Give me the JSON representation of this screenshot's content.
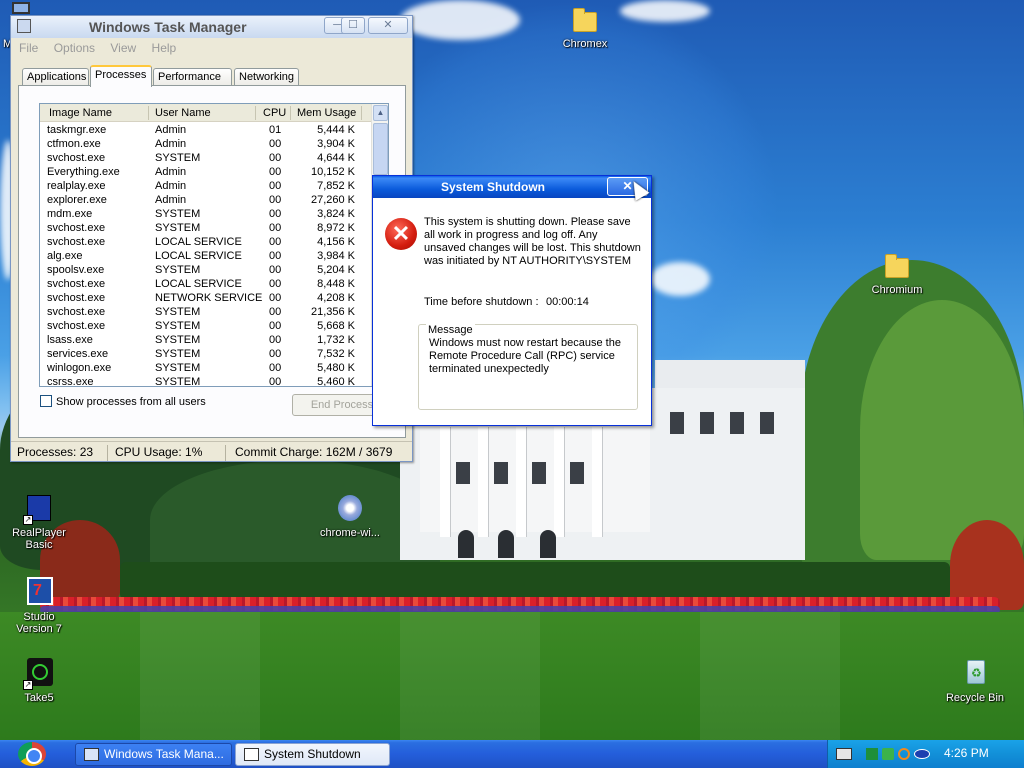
{
  "desktop": {
    "icons": [
      {
        "id": "chromex",
        "label": "Chromex"
      },
      {
        "id": "chromium",
        "label": "Chromium"
      },
      {
        "id": "realplayer",
        "label": "RealPlayer Basic"
      },
      {
        "id": "chrome-wi",
        "label": "chrome-wi..."
      },
      {
        "id": "studio",
        "label": "Studio Version 7"
      },
      {
        "id": "take5",
        "label": "Take5"
      },
      {
        "id": "recycle",
        "label": "Recycle Bin"
      },
      {
        "id": "my-computer",
        "label": "M"
      }
    ]
  },
  "taskmgr": {
    "title": "Windows Task Manager",
    "menu": [
      "File",
      "Options",
      "View",
      "Help"
    ],
    "tabs": [
      "Applications",
      "Processes",
      "Performance",
      "Networking"
    ],
    "active_tab": "Processes",
    "columns": [
      "Image Name",
      "User Name",
      "CPU",
      "Mem Usage"
    ],
    "processes": [
      [
        "taskmgr.exe",
        "Admin",
        "01",
        "5,444 K"
      ],
      [
        "ctfmon.exe",
        "Admin",
        "00",
        "3,904 K"
      ],
      [
        "svchost.exe",
        "SYSTEM",
        "00",
        "4,644 K"
      ],
      [
        "Everything.exe",
        "Admin",
        "00",
        "10,152 K"
      ],
      [
        "realplay.exe",
        "Admin",
        "00",
        "7,852 K"
      ],
      [
        "explorer.exe",
        "Admin",
        "00",
        "27,260 K"
      ],
      [
        "mdm.exe",
        "SYSTEM",
        "00",
        "3,824 K"
      ],
      [
        "svchost.exe",
        "SYSTEM",
        "00",
        "8,972 K"
      ],
      [
        "svchost.exe",
        "LOCAL SERVICE",
        "00",
        "4,156 K"
      ],
      [
        "alg.exe",
        "LOCAL SERVICE",
        "00",
        "3,984 K"
      ],
      [
        "spoolsv.exe",
        "SYSTEM",
        "00",
        "5,204 K"
      ],
      [
        "svchost.exe",
        "LOCAL SERVICE",
        "00",
        "8,448 K"
      ],
      [
        "svchost.exe",
        "NETWORK SERVICE",
        "00",
        "4,208 K"
      ],
      [
        "svchost.exe",
        "SYSTEM",
        "00",
        "21,356 K"
      ],
      [
        "svchost.exe",
        "SYSTEM",
        "00",
        "5,668 K"
      ],
      [
        "lsass.exe",
        "SYSTEM",
        "00",
        "1,732 K"
      ],
      [
        "services.exe",
        "SYSTEM",
        "00",
        "7,532 K"
      ],
      [
        "winlogon.exe",
        "SYSTEM",
        "00",
        "5,480 K"
      ],
      [
        "csrss.exe",
        "SYSTEM",
        "00",
        "5,460 K"
      ]
    ],
    "show_all_label": "Show processes from all users",
    "end_process_label": "End Process",
    "status": {
      "processes": "Processes: 23",
      "cpu": "CPU Usage: 1%",
      "commit": "Commit Charge: 162M / 3679"
    }
  },
  "shutdown": {
    "title": "System Shutdown",
    "close_label": "✕",
    "body": "This system is shutting down. Please save all work in progress and log off. Any unsaved changes will be lost. This shutdown was initiated by NT AUTHORITY\\SYSTEM",
    "timer_label": "Time before shutdown :",
    "timer_value": "00:00:14",
    "message_legend": "Message",
    "message_text": "Windows must now restart because the Remote Procedure Call (RPC) service terminated unexpectedly"
  },
  "taskbar": {
    "buttons": [
      "Windows Task Mana...",
      "System Shutdown"
    ],
    "clock": "4:26 PM"
  }
}
